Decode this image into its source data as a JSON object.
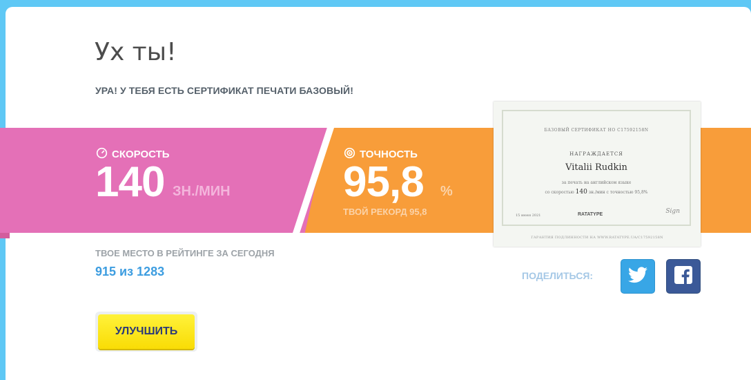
{
  "header": {
    "title": "Ух ты!",
    "subtitle": "УРА! У ТЕБЯ ЕСТЬ СЕРТИФИКАТ ПЕЧАТИ БАЗОВЫЙ!"
  },
  "speed": {
    "label": "СКОРОСТЬ",
    "icon": "speedometer-icon",
    "value": "140",
    "unit": "ЗН./МИН"
  },
  "accuracy": {
    "label": "ТОЧНОСТЬ",
    "icon": "target-icon",
    "value": "95,8",
    "unit": "%",
    "record": "ТВОЙ РЕКОРД 95,8"
  },
  "certificate": {
    "number_line": "БАЗОВЫЙ СЕРТИФИКАТ НО C17592158N",
    "awarded": "НАГРАЖДАЕТСЯ",
    "name": "Vitalii Rudkin",
    "line1": "за печать на английском языке",
    "line2_prefix": "со скоростью",
    "line2_speed": "140",
    "line2_suffix": "зн./мин с точностью 95,8%",
    "date": "15 июня 2021",
    "brand": "RATATYPE",
    "signature": "Sign",
    "footer": "ГАРАНТИЯ ПОДЛИННОСТИ НА WWW.RATATYPE.UA/C17592158N"
  },
  "rating": {
    "label": "ТВОЕ МЕСТО В РЕЙТИНГЕ ЗА СЕГОДНЯ",
    "value": "915 из 1283"
  },
  "share": {
    "label": "ПОДЕЛИТЬСЯ:",
    "twitter_icon": "twitter-icon",
    "facebook_icon": "facebook-icon"
  },
  "actions": {
    "improve_label": "УЛУЧШИТЬ"
  },
  "colors": {
    "background": "#5fc8f5",
    "speed_pink": "#e470b7",
    "accuracy_orange": "#f89d3a",
    "link_blue": "#3d9de0",
    "button_yellow": "#ffea1f",
    "twitter": "#38a6e6",
    "facebook": "#3b5998"
  }
}
